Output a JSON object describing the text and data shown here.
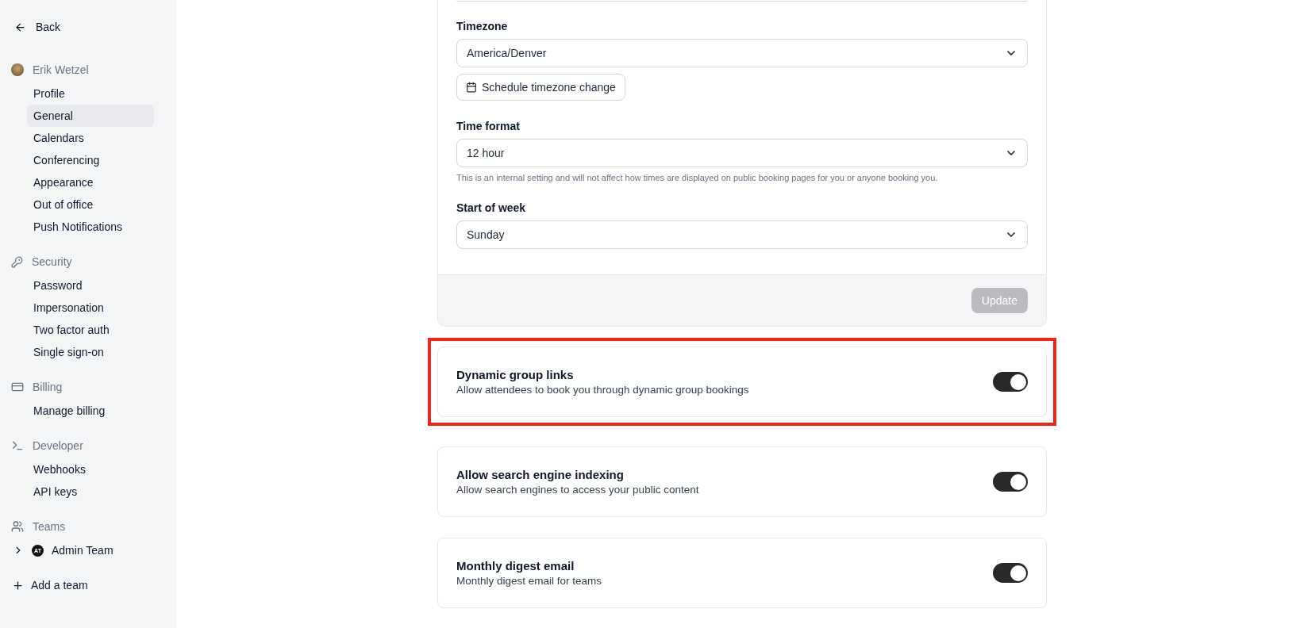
{
  "sidebar": {
    "back": {
      "label": "Back"
    },
    "sections": [
      {
        "kind": "user",
        "title": "Erik Wetzel",
        "items": [
          {
            "label": "Profile",
            "selected": false
          },
          {
            "label": "General",
            "selected": true
          },
          {
            "label": "Calendars",
            "selected": false
          },
          {
            "label": "Conferencing",
            "selected": false
          },
          {
            "label": "Appearance",
            "selected": false
          },
          {
            "label": "Out of office",
            "selected": false
          },
          {
            "label": "Push Notifications",
            "selected": false
          }
        ]
      },
      {
        "kind": "security",
        "title": "Security",
        "items": [
          {
            "label": "Password",
            "selected": false
          },
          {
            "label": "Impersonation",
            "selected": false
          },
          {
            "label": "Two factor auth",
            "selected": false
          },
          {
            "label": "Single sign-on",
            "selected": false
          }
        ]
      },
      {
        "kind": "billing",
        "title": "Billing",
        "items": [
          {
            "label": "Manage billing",
            "selected": false
          }
        ]
      },
      {
        "kind": "developer",
        "title": "Developer",
        "items": [
          {
            "label": "Webhooks",
            "selected": false
          },
          {
            "label": "API keys",
            "selected": false
          }
        ]
      },
      {
        "kind": "teams",
        "title": "Teams",
        "teams": [
          {
            "badge": "AT",
            "name": "Admin Team",
            "expanded": false
          }
        ]
      }
    ],
    "add_team": {
      "label": "Add a team"
    }
  },
  "form": {
    "fields": [
      {
        "label": "Timezone",
        "value": "America/Denver",
        "action": "Schedule timezone change"
      },
      {
        "label": "Time format",
        "value": "12 hour",
        "hint": "This is an internal setting and will not affect how times are displayed on public booking pages for you or anyone booking you."
      },
      {
        "label": "Start of week",
        "value": "Sunday"
      }
    ],
    "submit": {
      "label": "Update",
      "disabled": true
    }
  },
  "settings": [
    {
      "title": "Dynamic group links",
      "description": "Allow attendees to book you through dynamic group bookings",
      "on": true,
      "highlighted": true
    },
    {
      "title": "Allow search engine indexing",
      "description": "Allow search engines to access your public content",
      "on": true,
      "highlighted": false
    },
    {
      "title": "Monthly digest email",
      "description": "Monthly digest email for teams",
      "on": true,
      "highlighted": false
    }
  ]
}
